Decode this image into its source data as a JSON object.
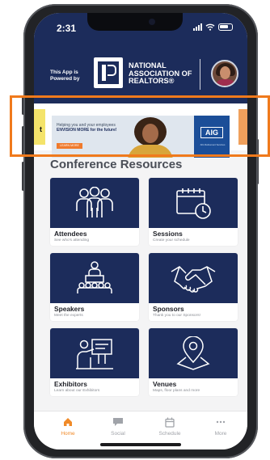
{
  "status": {
    "time": "2:31"
  },
  "header": {
    "powered_by": "This App is Powered by",
    "org_line1": "NATIONAL",
    "org_line2": "ASSOCIATION OF",
    "org_line3": "REALTORS®"
  },
  "ad": {
    "line1": "Helping you and your employees",
    "line2": "ENVISION MORE for the future!",
    "cta": "LEARN MORE",
    "brand": "AIG",
    "brand_sub": "AIG Retirement Services",
    "peek_left": "t"
  },
  "section_title": "Conference Resources",
  "tiles": [
    {
      "title": "Attendees",
      "subtitle": "See who's attending",
      "icon": "people-group-icon"
    },
    {
      "title": "Sessions",
      "subtitle": "Create your schedule",
      "icon": "calendar-clock-icon"
    },
    {
      "title": "Speakers",
      "subtitle": "Meet the experts",
      "icon": "podium-speaker-icon"
    },
    {
      "title": "Sponsors",
      "subtitle": "Thank you to our Sponsors!",
      "icon": "handshake-icon"
    },
    {
      "title": "Exhibitors",
      "subtitle": "Learn about our Exhibitors",
      "icon": "exhibitor-board-icon"
    },
    {
      "title": "Venues",
      "subtitle": "Maps, floor plans and more",
      "icon": "map-pin-icon"
    }
  ],
  "tabs": [
    {
      "label": "Home",
      "icon": "home-icon",
      "active": true
    },
    {
      "label": "Social",
      "icon": "chat-bubble-icon",
      "active": false
    },
    {
      "label": "Schedule",
      "icon": "calendar-icon",
      "active": false
    },
    {
      "label": "More",
      "icon": "more-dots-icon",
      "active": false
    }
  ],
  "colors": {
    "header": "#1c2c5b",
    "tile_art": "#1c2c5b",
    "accent": "#f08a28",
    "highlight_box": "#f07a1c"
  }
}
